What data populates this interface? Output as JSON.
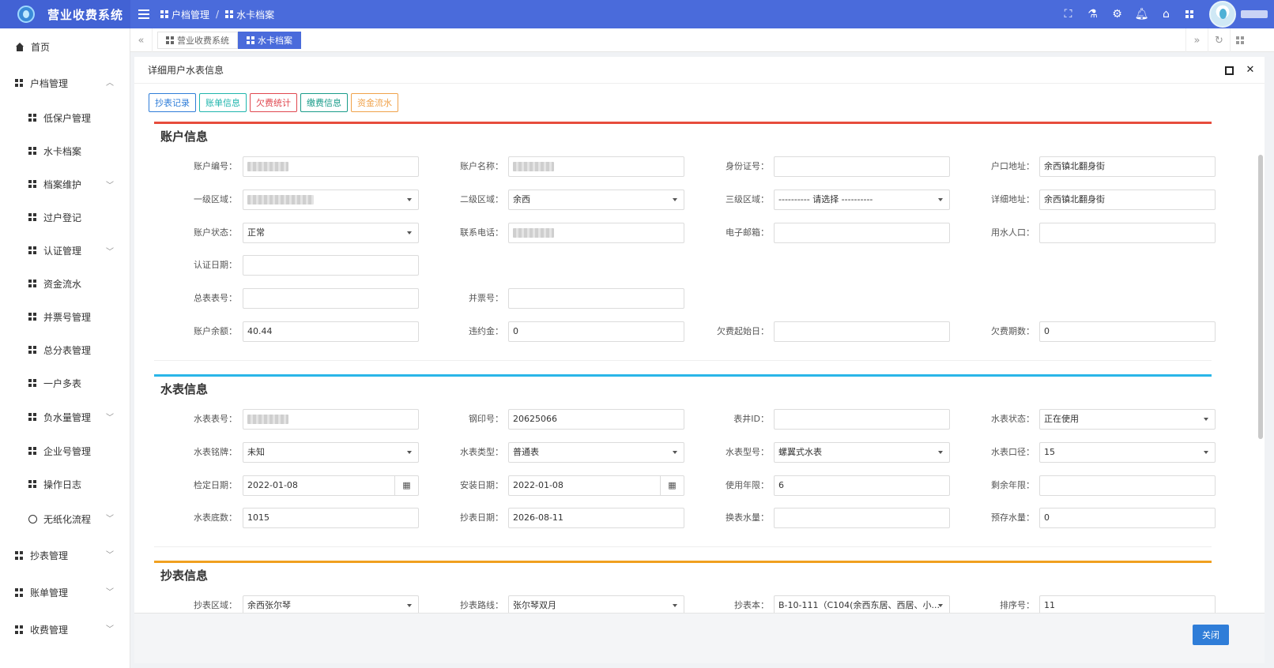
{
  "header": {
    "app_title": "营业收费系统",
    "breadcrumbs": [
      "户档管理",
      "水卡档案"
    ],
    "separator": "/"
  },
  "sidebar": {
    "items": [
      {
        "label": "首页",
        "level": "top",
        "icon": "home-icon"
      },
      {
        "label": "户档管理",
        "level": "top",
        "icon": "grid-icon",
        "chevron": "⌃"
      },
      {
        "label": "低保户管理",
        "level": "sub",
        "icon": "grid-icon"
      },
      {
        "label": "水卡档案",
        "level": "sub",
        "icon": "grid-icon"
      },
      {
        "label": "档案维护",
        "level": "sub",
        "icon": "grid-icon",
        "chevron": "⌄"
      },
      {
        "label": "过户登记",
        "level": "sub",
        "icon": "grid-icon"
      },
      {
        "label": "认证管理",
        "level": "sub",
        "icon": "grid-icon",
        "chevron": "⌄"
      },
      {
        "label": "资金流水",
        "level": "sub",
        "icon": "grid-icon"
      },
      {
        "label": "并票号管理",
        "level": "sub",
        "icon": "grid-icon"
      },
      {
        "label": "总分表管理",
        "level": "sub",
        "icon": "grid-icon"
      },
      {
        "label": "一户多表",
        "level": "sub",
        "icon": "grid-icon"
      },
      {
        "label": "负水量管理",
        "level": "sub",
        "icon": "grid-icon",
        "chevron": "⌄"
      },
      {
        "label": "企业号管理",
        "level": "sub",
        "icon": "grid-icon"
      },
      {
        "label": "操作日志",
        "level": "sub",
        "icon": "grid-icon"
      },
      {
        "label": "无纸化流程",
        "level": "sub",
        "icon": "clock-icon",
        "chevron": "⌄"
      },
      {
        "label": "抄表管理",
        "level": "top",
        "icon": "grid-icon",
        "chevron": "⌄"
      },
      {
        "label": "账单管理",
        "level": "top",
        "icon": "grid-icon",
        "chevron": "⌄"
      },
      {
        "label": "收费管理",
        "level": "top",
        "icon": "grid-icon",
        "chevron": "⌄"
      }
    ]
  },
  "tabs": [
    {
      "label": "营业收费系统",
      "active": false
    },
    {
      "label": "水卡档案",
      "active": true
    }
  ],
  "panel": {
    "title": "详细用户水表信息",
    "close_glyph": "✕",
    "buttons": [
      {
        "label": "抄表记录",
        "color": "#2f7dd8"
      },
      {
        "label": "账单信息",
        "color": "#1fb5ad"
      },
      {
        "label": "欠费统计",
        "color": "#e0474f"
      },
      {
        "label": "缴费信息",
        "color": "#1a9c8a"
      },
      {
        "label": "资金流水",
        "color": "#f0a24a"
      }
    ]
  },
  "sections": {
    "account": {
      "title": "账户信息",
      "color": "#e74c3c",
      "fields": [
        {
          "label": "账户编号：",
          "value": "",
          "blur": true
        },
        {
          "label": "账户名称：",
          "value": "",
          "blur": true
        },
        {
          "label": "身份证号：",
          "value": ""
        },
        {
          "label": "户口地址：",
          "value": "余西镇北翻身街"
        },
        {
          "label": "一级区域：",
          "value": "",
          "blur": true,
          "select": true
        },
        {
          "label": "二级区域：",
          "value": "余西",
          "select": true
        },
        {
          "label": "三级区域：",
          "value": "---------- 请选择 ----------",
          "select": true
        },
        {
          "label": "详细地址：",
          "value": "余西镇北翻身街"
        },
        {
          "label": "账户状态：",
          "value": "正常",
          "select": true
        },
        {
          "label": "联系电话：",
          "value": "",
          "blur": true
        },
        {
          "label": "电子邮箱：",
          "value": ""
        },
        {
          "label": "用水人口：",
          "value": ""
        },
        {
          "label": "认证日期：",
          "value": ""
        },
        {
          "label": "总表表号：",
          "value": ""
        },
        {
          "label": "并票号：",
          "value": ""
        },
        {
          "label": "账户余额：",
          "value": "40.44"
        },
        {
          "label": "违约金：",
          "value": "0"
        },
        {
          "label": "欠费起始日：",
          "value": ""
        },
        {
          "label": "欠费期数：",
          "value": "0"
        }
      ]
    },
    "meter": {
      "title": "水表信息",
      "color": "#29b6e8",
      "fields": [
        {
          "label": "水表表号：",
          "value": "",
          "blur": true
        },
        {
          "label": "钢印号：",
          "value": "20625066"
        },
        {
          "label": "表井ID：",
          "value": ""
        },
        {
          "label": "水表状态：",
          "value": "正在使用",
          "select": true
        },
        {
          "label": "水表铭牌：",
          "value": "未知",
          "select": true
        },
        {
          "label": "水表类型：",
          "value": "普通表",
          "select": true
        },
        {
          "label": "水表型号：",
          "value": "螺翼式水表",
          "select": true
        },
        {
          "label": "水表口径：",
          "value": "15",
          "select": true
        },
        {
          "label": "检定日期：",
          "value": "2022-01-08",
          "calendar": true
        },
        {
          "label": "安装日期：",
          "value": "2022-01-08",
          "calendar": true
        },
        {
          "label": "使用年限：",
          "value": "6"
        },
        {
          "label": "剩余年限：",
          "value": ""
        },
        {
          "label": "水表底数：",
          "value": "1015"
        },
        {
          "label": "抄表日期：",
          "value": "2026-08-11"
        },
        {
          "label": "换表水量：",
          "value": ""
        },
        {
          "label": "预存水量：",
          "value": "0"
        }
      ]
    },
    "reading": {
      "title": "抄表信息",
      "color": "#f0a020",
      "fields": [
        {
          "label": "抄表区域：",
          "value": "余西张尔琴",
          "select": true
        },
        {
          "label": "抄表路线：",
          "value": "张尔琴双月",
          "select": true
        },
        {
          "label": "抄表本：",
          "value": "B-10-111（C104(余西东居、西居、小...",
          "select": true
        },
        {
          "label": "排序号：",
          "value": "11"
        }
      ]
    }
  },
  "footer": {
    "close_label": "关闭"
  }
}
